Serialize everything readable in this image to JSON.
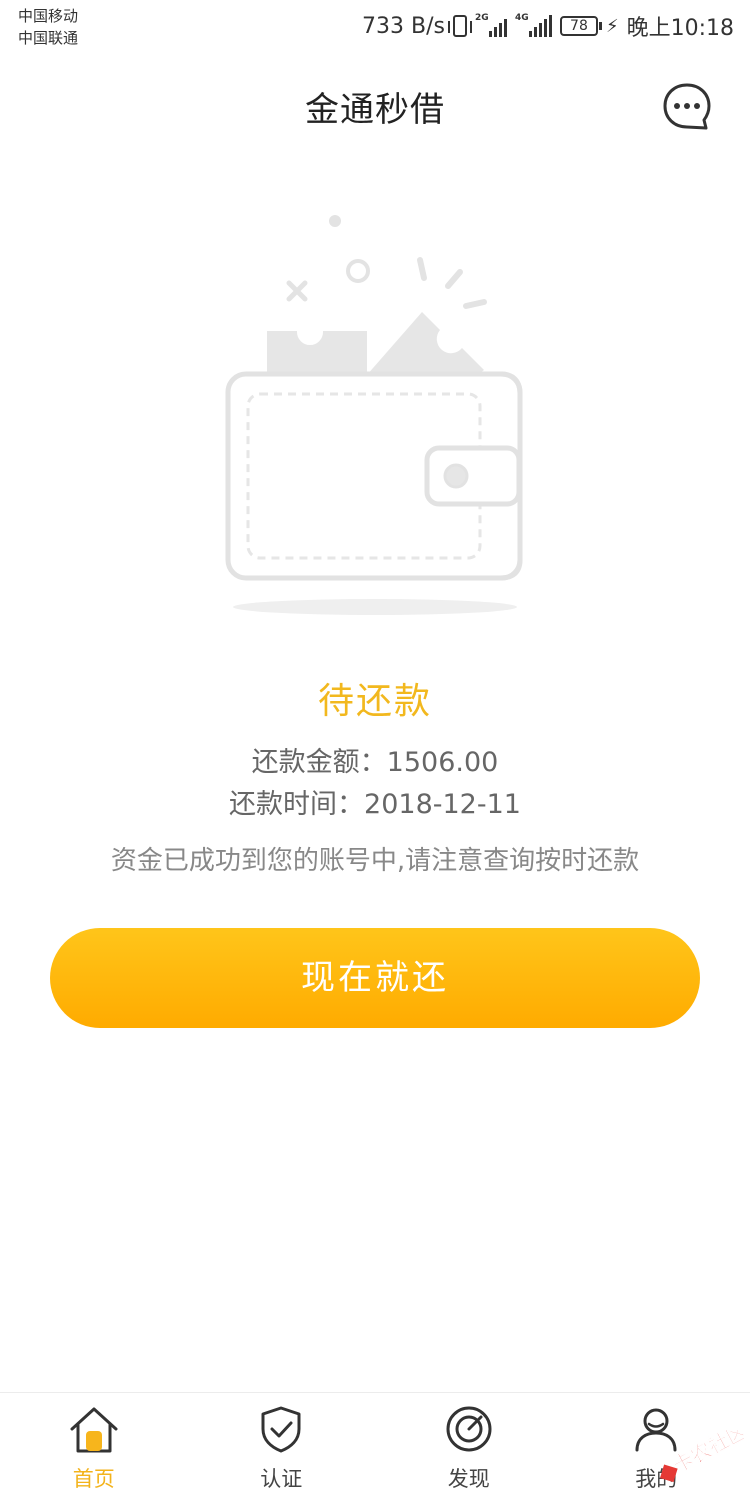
{
  "status_bar": {
    "carrier_1": "中国移动",
    "carrier_2": "中国联通",
    "speed": "733 B/s",
    "net_1": "2G",
    "net_2": "4G",
    "battery": "78",
    "time": "晚上10:18"
  },
  "header": {
    "title": "金通秒借",
    "message_icon": "chat-bubble-icon"
  },
  "loan": {
    "status": "待还款",
    "amount_line": "还款金额：1506.00",
    "date_line": "还款时间：2018-12-11",
    "notice": "资金已成功到您的账号中,请注意查询按时还款",
    "button_label": "现在就还"
  },
  "tabs": [
    {
      "label": "首页",
      "icon": "home-icon",
      "active": true
    },
    {
      "label": "认证",
      "icon": "shield-check-icon",
      "active": false
    },
    {
      "label": "发现",
      "icon": "compass-icon",
      "active": false
    },
    {
      "label": "我的",
      "icon": "user-icon",
      "active": false
    }
  ],
  "watermark": "卡农社区",
  "colors": {
    "accent": "#f2b81e",
    "button_top": "#ffc51a",
    "button_bottom": "#ffab00"
  }
}
